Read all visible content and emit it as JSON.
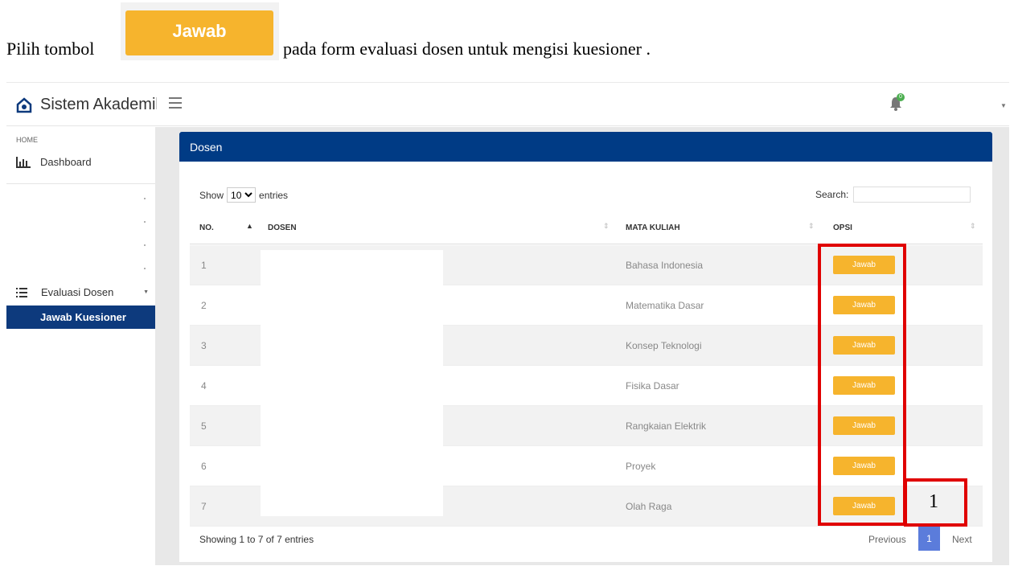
{
  "instruction": {
    "prefix": "Pilih tombol",
    "button_label": "Jawab",
    "suffix": "pada form evaluasi dosen untuk mengisi kuesioner ."
  },
  "app": {
    "title": "Sistem Akademik",
    "notification_count": "0"
  },
  "sidebar": {
    "home_label": "HOME",
    "dashboard": "Dashboard",
    "evaluasi": "Evaluasi Dosen",
    "jawab_kuesioner": "Jawab Kuesioner"
  },
  "card": {
    "title": "Dosen"
  },
  "controls": {
    "show_label": "Show",
    "entries_value": "10",
    "entries_label": "entries",
    "search_label": "Search:"
  },
  "table": {
    "headers": [
      "NO.",
      "DOSEN",
      "MATA KULIAH",
      "OPSI"
    ],
    "rows": [
      {
        "no": "1",
        "mata_kuliah": "Bahasa Indonesia",
        "opsi": "Jawab"
      },
      {
        "no": "2",
        "mata_kuliah": "Matematika Dasar",
        "opsi": "Jawab"
      },
      {
        "no": "3",
        "mata_kuliah": "Konsep Teknologi",
        "opsi": "Jawab"
      },
      {
        "no": "4",
        "mata_kuliah": "Fisika Dasar",
        "opsi": "Jawab"
      },
      {
        "no": "5",
        "mata_kuliah": "Rangkaian Elektrik",
        "opsi": "Jawab"
      },
      {
        "no": "6",
        "mata_kuliah": "Proyek",
        "opsi": "Jawab"
      },
      {
        "no": "7",
        "mata_kuliah": "Olah Raga",
        "opsi": "Jawab"
      }
    ]
  },
  "footer": {
    "info": "Showing 1 to 7 of 7 entries",
    "previous": "Previous",
    "page": "1",
    "next": "Next"
  },
  "annotation": {
    "label": "1",
    "color": "#e00000"
  },
  "colors": {
    "accent_yellow": "#f6b42d",
    "header_blue": "#003b85",
    "sidebar_active": "#0d3a7d",
    "pagination_active": "#5b7cdb"
  }
}
